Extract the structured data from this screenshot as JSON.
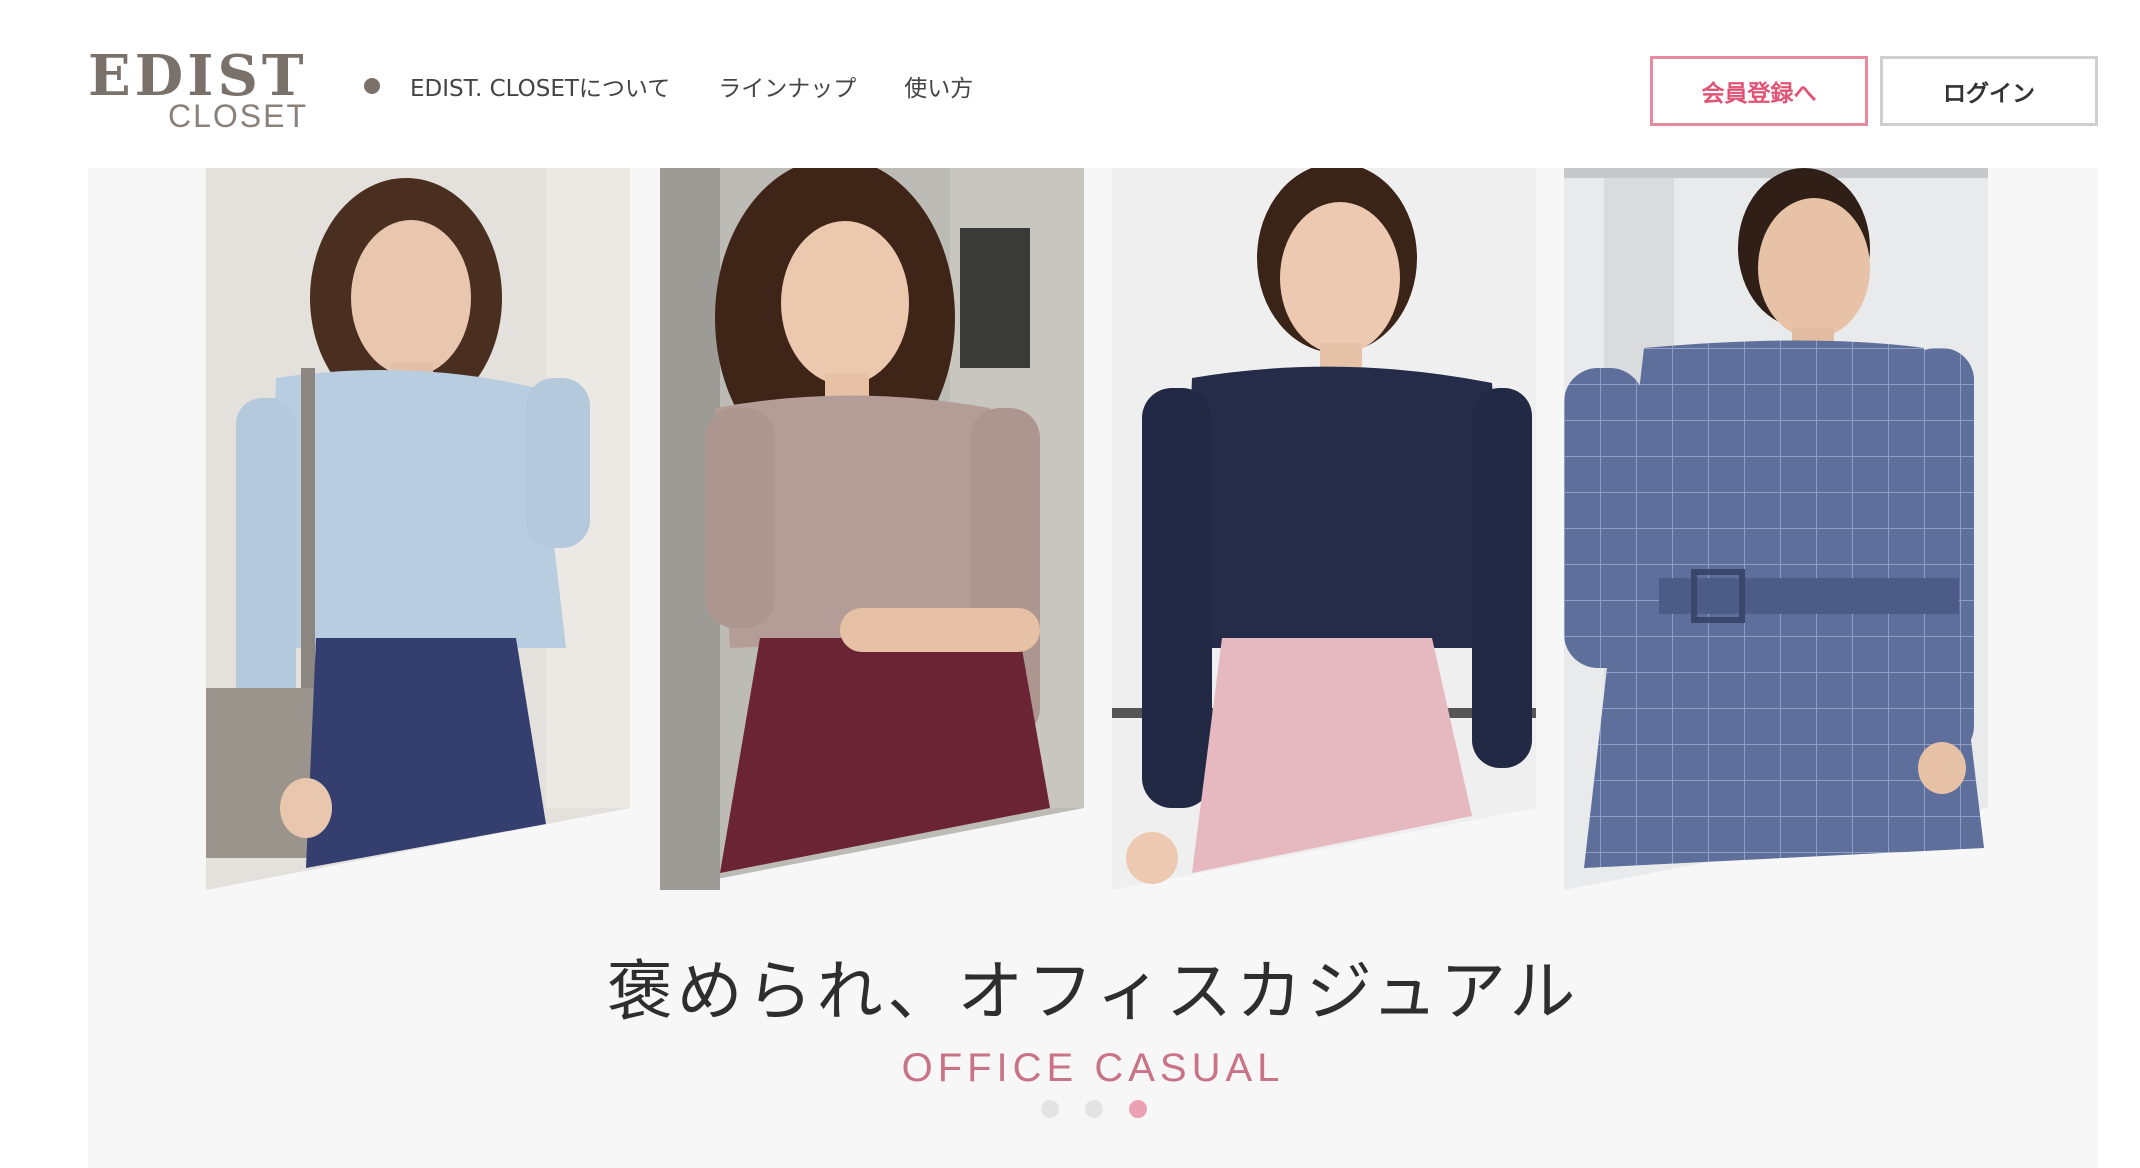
{
  "header": {
    "logo_text": "EDIST",
    "logo_sub": "CLOSET",
    "nav": [
      {
        "label": "EDIST. CLOSETについて"
      },
      {
        "label": "ラインナップ"
      },
      {
        "label": "使い方"
      }
    ],
    "register_label": "会員登録へ",
    "login_label": "ログイン"
  },
  "hero": {
    "headline": "褒められ、オフィスカジュアル",
    "subline": "OFFICE CASUAL",
    "slides_total": 3,
    "active_slide": 3
  },
  "colors": {
    "accent_pink": "#e05576",
    "subline_pink": "#c97386",
    "logo_gray": "#7a716b"
  }
}
